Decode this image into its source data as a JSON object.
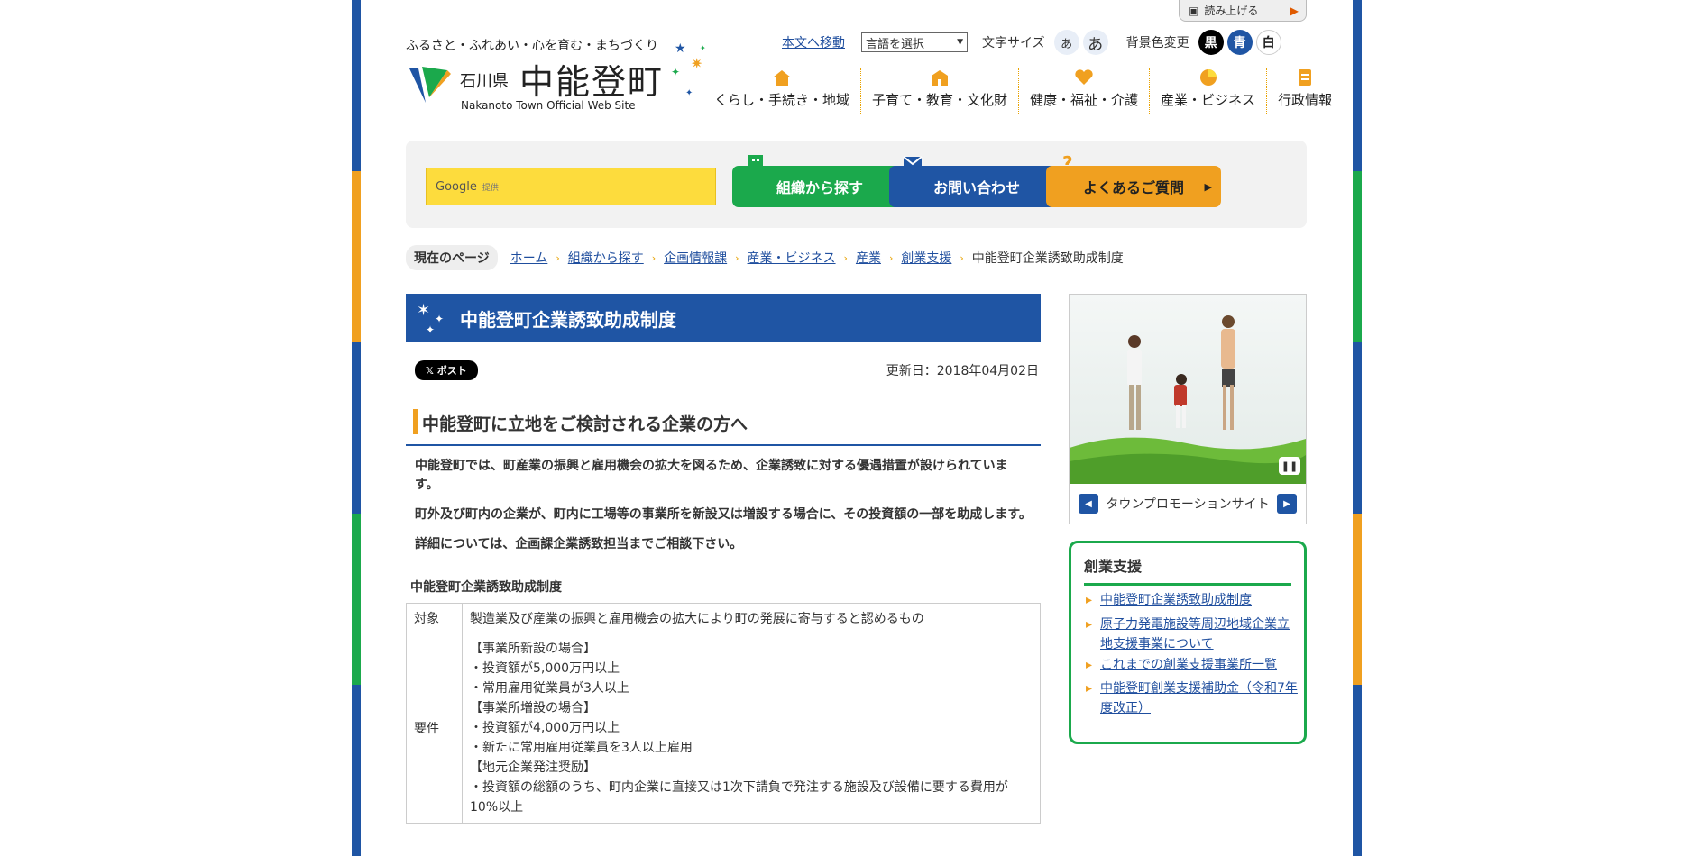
{
  "readbar": {
    "label": "読み上げる"
  },
  "header": {
    "tagline": "ふるさと・ふれあい・心を育む・まちづくり",
    "prefecture": "石川県",
    "town": "中能登町",
    "town_en": "Nakanoto Town Official Web Site"
  },
  "toplinks": {
    "skip": "本文へ移動",
    "language": "言語を選択",
    "fontsize_label": "文字サイズ",
    "fontsize_small": "あ",
    "fontsize_large": "あ",
    "bg_label": "背景色変更",
    "bg_black": "黒",
    "bg_blue": "青",
    "bg_white": "白"
  },
  "gnav": [
    {
      "label": "くらし・手続き・地域",
      "icon": "house-icon"
    },
    {
      "label": "子育て・教育・文化財",
      "icon": "school-icon"
    },
    {
      "label": "健康・福祉・介護",
      "icon": "heart-icon"
    },
    {
      "label": "産業・ビジネス",
      "icon": "pie-chart-icon"
    },
    {
      "label": "行政情報",
      "icon": "document-icon"
    }
  ],
  "search": {
    "brand": "Google",
    "provided": "提供"
  },
  "quick": {
    "org": "組織から探す",
    "contact": "お問い合わせ",
    "faq": "よくあるご質問"
  },
  "breadcrumb": {
    "current_label": "現在のページ",
    "items": [
      "ホーム",
      "組織から探す",
      "企画情報課",
      "産業・ビジネス",
      "産業",
      "創業支援"
    ],
    "last": "中能登町企業誘致助成制度"
  },
  "main": {
    "title": "中能登町企業誘致助成制度",
    "x_post": "ポスト",
    "updated": "更新日：2018年04月02日",
    "heading": "中能登町に立地をご検討される企業の方へ",
    "p1": "中能登町では、町産業の振興と雇用機会の拡大を図るため、企業誘致に対する優遇措置が設けられています。",
    "p2": "町外及び町内の企業が、町内に工場等の事業所を新設又は増設する場合に、その投資額の一部を助成します。",
    "p3": "詳細については、企画課企業誘致担当までご相談下さい。",
    "table_caption": "中能登町企業誘致助成制度",
    "row1_head": "対象",
    "row1_body": "製造業及び産業の振興と雇用機会の拡大により町の発展に寄与すると認めるもの",
    "row2_head": "要件",
    "row2_lines": [
      "【事業所新設の場合】",
      "・投資額が5,000万円以上",
      "・常用雇用従業員が3人以上",
      "【事業所増設の場合】",
      "・投資額が4,000万円以上",
      "・新たに常用雇用従業員を3人以上雇用",
      "【地元企業発注奨励】",
      "・投資額の総額のうち、町内企業に直接又は1次下請負で発注する施設及び設備に要する費用が10%以上"
    ]
  },
  "side": {
    "promo_label": "タウンプロモーションサイト",
    "box_title": "創業支援",
    "links": [
      "中能登町企業誘致助成制度",
      "原子力発電施設等周辺地域企業立地支援事業について",
      "これまでの創業支援事業所一覧",
      "中能登町創業支援補助金（令和7年度改正）"
    ]
  }
}
